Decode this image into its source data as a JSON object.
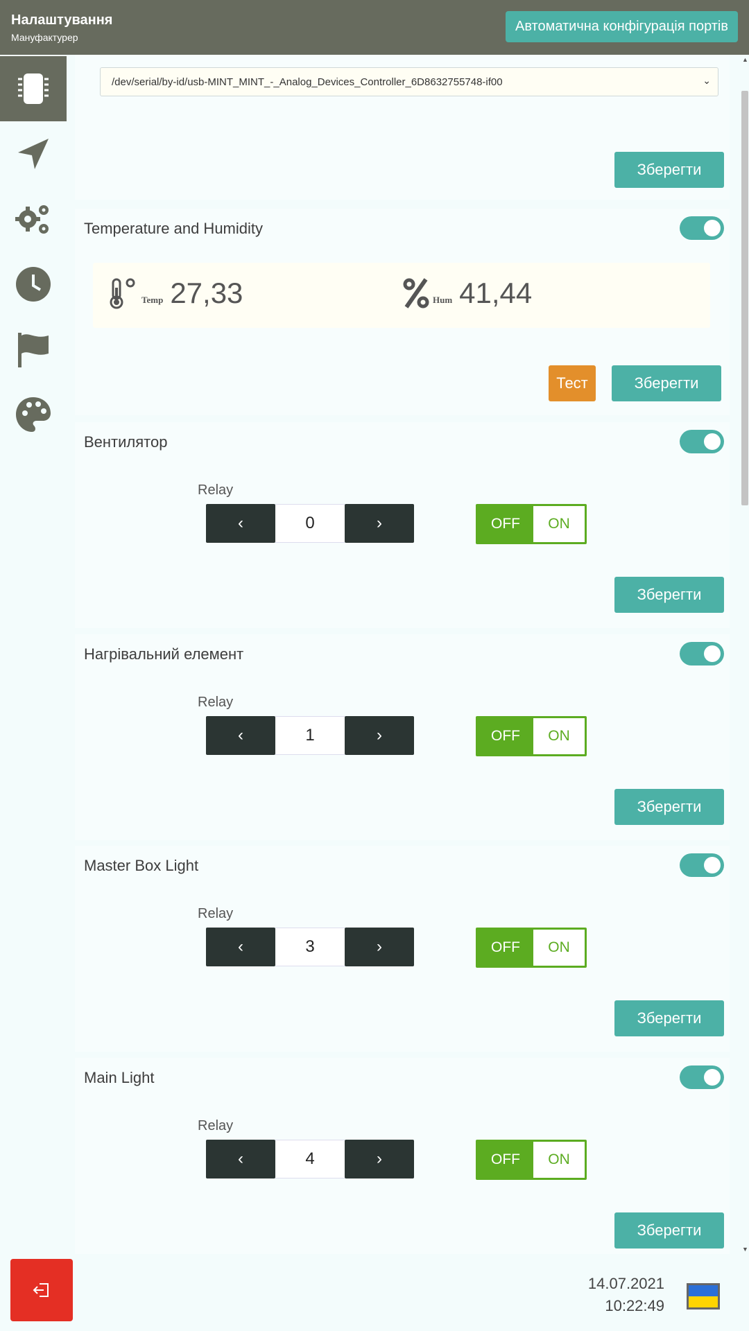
{
  "header": {
    "title": "Налаштування",
    "subtitle": "Мануфактурер",
    "auto_config_label": "Автоматична конфігурація портів"
  },
  "sidebar": {
    "items": [
      {
        "icon": "chip-icon",
        "active": true
      },
      {
        "icon": "location-arrow-icon"
      },
      {
        "icon": "gears-icon"
      },
      {
        "icon": "clock-icon"
      },
      {
        "icon": "flag-icon"
      },
      {
        "icon": "palette-icon"
      }
    ]
  },
  "port_card": {
    "port_value": "/dev/serial/by-id/usb-MINT_MINT_-_Analog_Devices_Controller_6D8632755748-if00",
    "save_label": "Зберегти"
  },
  "temperature_card": {
    "title": "Temperature and Humidity",
    "temp_label": "Temp",
    "temp_value": "27,33",
    "hum_label": "Hum",
    "hum_value": "41,44",
    "test_label": "Тест",
    "save_label": "Зберегти"
  },
  "relays": [
    {
      "title": "Вентилятор",
      "relay_label": "Relay",
      "value": "0",
      "off_label": "OFF",
      "on_label": "ON",
      "save_label": "Зберегти"
    },
    {
      "title": "Нагрівальний елемент",
      "relay_label": "Relay",
      "value": "1",
      "off_label": "OFF",
      "on_label": "ON",
      "save_label": "Зберегти"
    },
    {
      "title": "Master Box Light",
      "relay_label": "Relay",
      "value": "3",
      "off_label": "OFF",
      "on_label": "ON",
      "save_label": "Зберегти"
    },
    {
      "title": "Main Light",
      "relay_label": "Relay",
      "value": "4",
      "off_label": "OFF",
      "on_label": "ON",
      "save_label": "Зберегти"
    }
  ],
  "footer": {
    "date": "14.07.2021",
    "time": "10:22:49"
  },
  "colors": {
    "header": "#676b5e",
    "accent": "#4cb1a6",
    "test": "#e38f2b",
    "switch_green": "#5cac21",
    "logout": "#e42f24"
  }
}
